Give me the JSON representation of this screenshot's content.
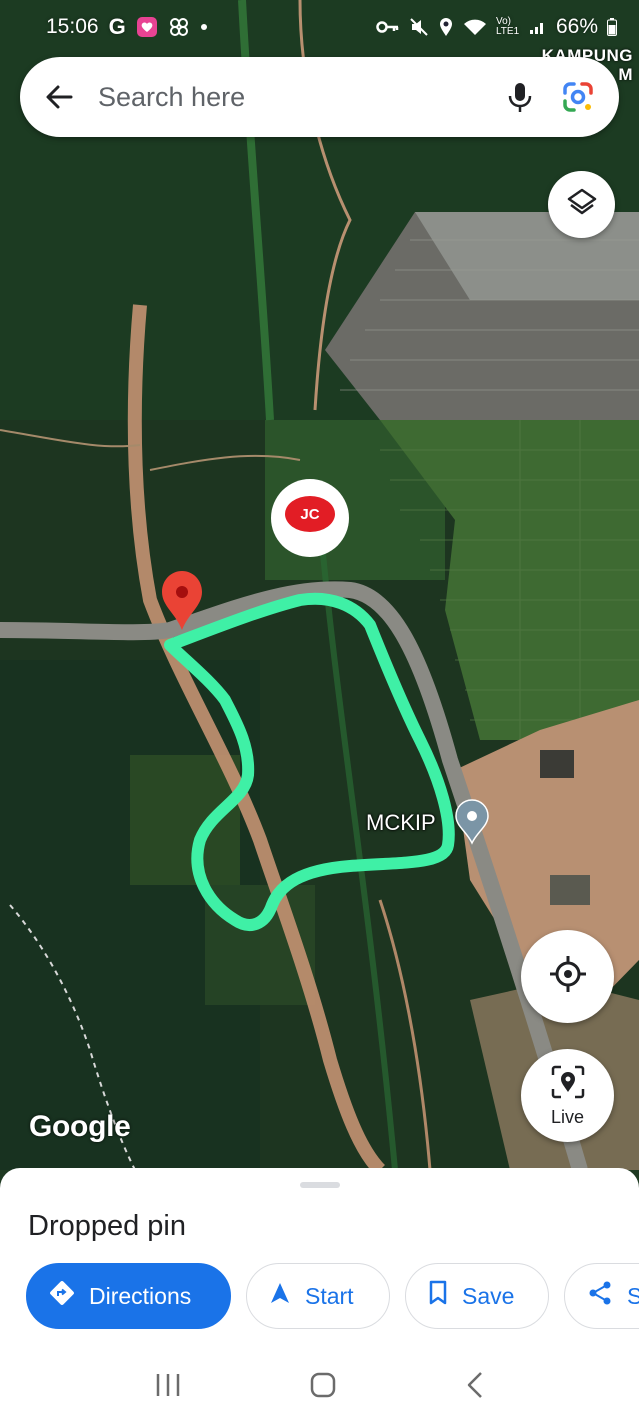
{
  "status_bar": {
    "time": "15:06",
    "left_icons": [
      "google-icon",
      "heart-app-icon",
      "flower-app-icon",
      "dot-icon"
    ],
    "right_icons": [
      "key-icon",
      "mute-icon",
      "location-icon",
      "wifi-icon"
    ],
    "network": "Vo) LTE1",
    "battery": "66%"
  },
  "search": {
    "placeholder": "Search here",
    "back_icon": "arrow-left-icon",
    "mic_icon": "mic-icon",
    "lens_icon": "google-lens-icon"
  },
  "map": {
    "area_label": "KAMPUNG\nM",
    "poi_label": "MCKIP",
    "attribution": "Google",
    "watermark_text": "JC",
    "pin_color": "#ea4335",
    "outline_color": "#3ff0a6",
    "poi_pin_color": "#7b95a6"
  },
  "map_controls": {
    "layers_icon": "layers-icon",
    "locate_icon": "my-location-icon",
    "live_label": "Live",
    "live_icon": "live-view-icon"
  },
  "place_sheet": {
    "title": "Dropped pin",
    "actions": [
      {
        "label": "Directions",
        "icon": "directions-icon"
      },
      {
        "label": "Start",
        "icon": "navigation-arrow-icon"
      },
      {
        "label": "Save",
        "icon": "bookmark-icon"
      },
      {
        "label": "Sh",
        "icon": "share-icon"
      }
    ]
  },
  "nav_bar": {
    "recents_icon": "recents-icon",
    "home_icon": "home-icon",
    "back_icon": "back-icon"
  },
  "colors": {
    "accent": "#1a73e8",
    "map_forest": "#1f3a22",
    "text_primary": "#202124"
  }
}
